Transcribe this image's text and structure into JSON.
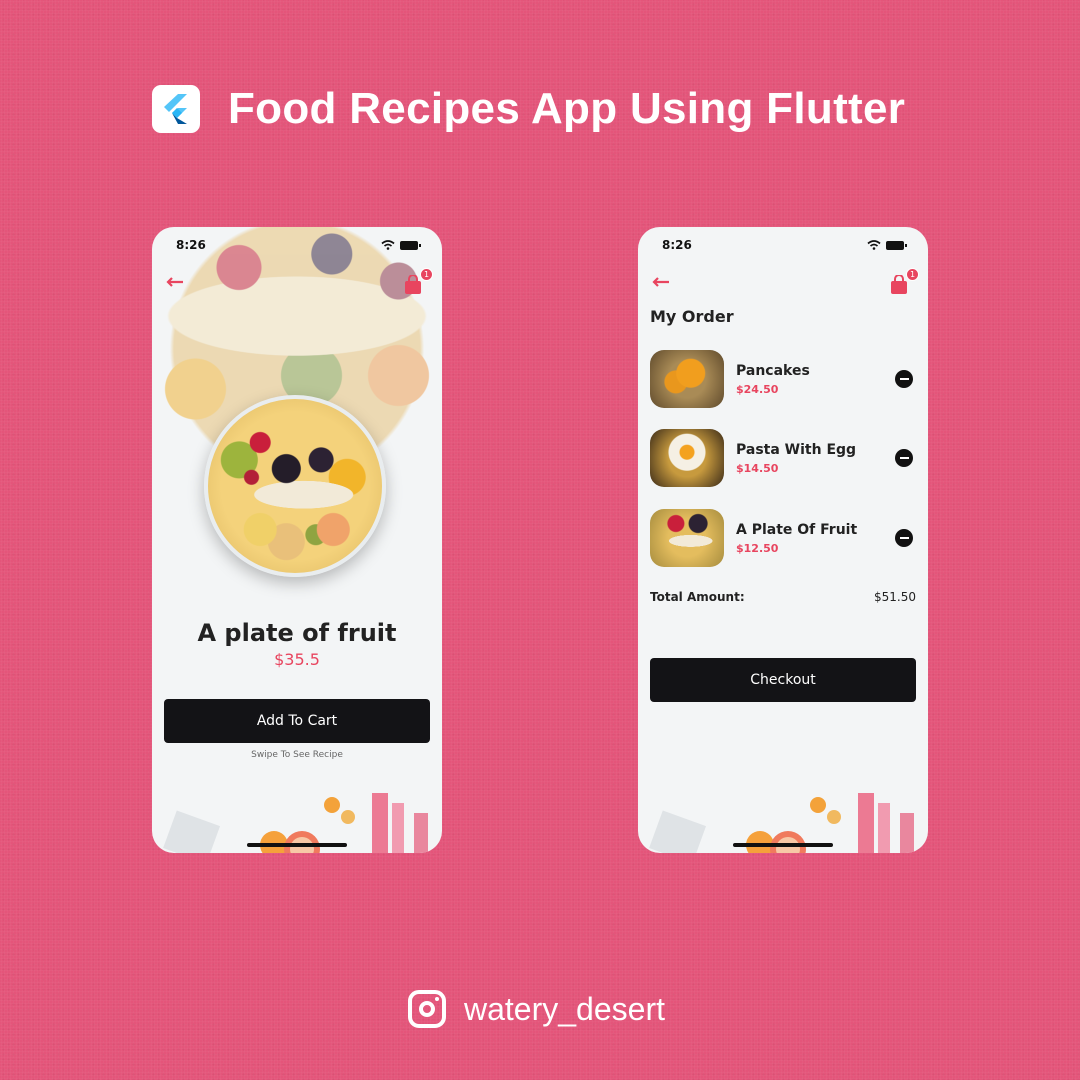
{
  "header": {
    "title": "Food Recipes App Using Flutter",
    "logo_icon": "flutter-logo-icon"
  },
  "footer": {
    "handle": "watery_desert",
    "icon": "instagram-icon"
  },
  "colors": {
    "background": "#e4557a",
    "accent": "#e8455f",
    "button": "#131316"
  },
  "phone1": {
    "status_time": "8:26",
    "cart_badge": "1",
    "product_name": "A plate of fruit",
    "product_price": "$35.5",
    "add_to_cart_label": "Add To Cart",
    "swipe_hint": "Swipe To See Recipe"
  },
  "phone2": {
    "status_time": "8:26",
    "cart_badge": "1",
    "title": "My Order",
    "items": [
      {
        "name": "Pancakes",
        "price": "$24.50"
      },
      {
        "name": "Pasta With Egg",
        "price": "$14.50"
      },
      {
        "name": "A Plate Of Fruit",
        "price": "$12.50"
      }
    ],
    "total_label": "Total Amount:",
    "total_value": "$51.50",
    "checkout_label": "Checkout"
  }
}
